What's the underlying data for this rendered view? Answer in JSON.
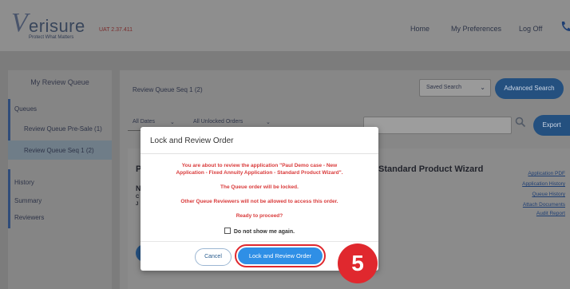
{
  "header": {
    "brand": "Verisure",
    "brand_initial": "V",
    "brand_rest": "erisure",
    "tagline": "Protect What Matters",
    "env_label": "UAT 2.37.411",
    "nav": [
      {
        "label": "Home"
      },
      {
        "label": "My Preferences"
      },
      {
        "label": "Log Off"
      }
    ],
    "phone_icon": "phone-icon"
  },
  "sidebar": {
    "title": "My Review Queue",
    "queues_label": "Queues",
    "queue_items": [
      {
        "label": "Review Queue Pre-Sale (1)"
      },
      {
        "label": "Review Queue Seq 1 (2)",
        "active": true
      }
    ],
    "other_items": [
      {
        "label": "History"
      },
      {
        "label": "Summary"
      },
      {
        "label": "Reviewers"
      }
    ]
  },
  "main": {
    "title": "Review Queue Seq 1 (2)",
    "saved_search": "Saved Search",
    "advanced_search": "Advanced Search",
    "filter_dates": "All Dates",
    "filter_orders": "All Unlocked Orders",
    "export": "Export",
    "bg_heading_initial": "P",
    "bg_wizard": "Standard Product Wizard",
    "bg_letter_n": "N",
    "bg_letter_c": "C",
    "bg_letter_j": "J",
    "side_links": [
      "Application PDF",
      "Application History",
      "Queue History",
      "Attach Documents",
      "Audit Report"
    ]
  },
  "modal": {
    "title": "Lock and Review Order",
    "message_line1": "You are about to review the application \"Paul Demo case - New",
    "message_line2": "Application - Fixed Annuity Application - Standard Product Wizard\".",
    "message_locked": "The Queue order will be locked.",
    "message_others": "Other Queue Reviewers will not be allowed to access this order.",
    "message_ready": "Ready to proceed?",
    "dont_show": "Do not show me again.",
    "cancel": "Cancel",
    "confirm": "Lock and Review Order"
  },
  "annotation": {
    "step": "5",
    "color": "#e0282e"
  },
  "colors": {
    "primary_button": "#2f8fe6",
    "warning_text": "#d93a3a",
    "overlay_bg": "#7c7c7c"
  }
}
